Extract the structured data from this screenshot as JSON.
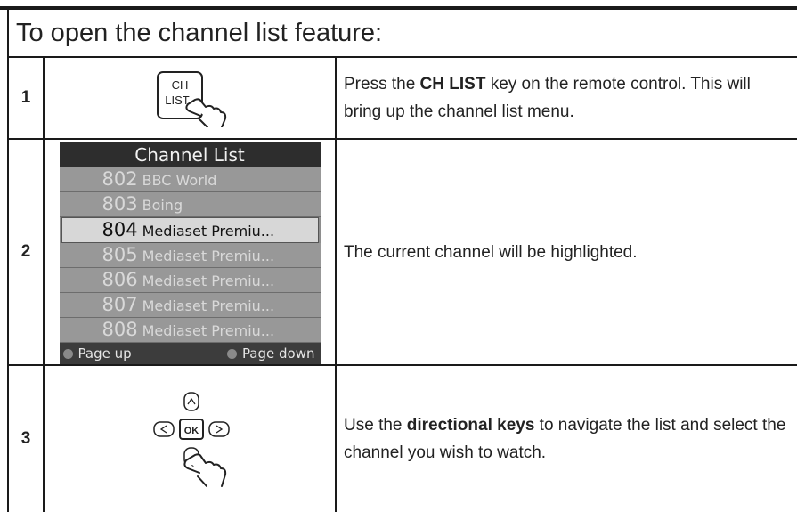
{
  "header": {
    "title": "To open the channel list feature:"
  },
  "steps": [
    {
      "number": "1",
      "key_label_line1": "CH",
      "key_label_line2": "LIST",
      "text_pre": "Press the ",
      "text_bold": "CH LIST",
      "text_post": " key on the remote control. This will bring up the channel list menu."
    },
    {
      "number": "2",
      "text": "The current channel will be highlighted."
    },
    {
      "number": "3",
      "ok_label": "OK",
      "text_pre": "Use the ",
      "text_bold": "directional keys",
      "text_post": " to navigate the list and select the channel you wish to watch."
    }
  ],
  "channel_list": {
    "title": "Channel List",
    "items": [
      {
        "num": "802",
        "name": "BBC World"
      },
      {
        "num": "803",
        "name": "Boing"
      },
      {
        "num": "804",
        "name": "Mediaset Premiu..."
      },
      {
        "num": "805",
        "name": "Mediaset Premiu..."
      },
      {
        "num": "806",
        "name": "Mediaset Premiu..."
      },
      {
        "num": "807",
        "name": "Mediaset Premiu..."
      },
      {
        "num": "808",
        "name": "Mediaset Premiu..."
      }
    ],
    "selected_index": 2,
    "footer_left": "Page up",
    "footer_right": "Page down"
  }
}
